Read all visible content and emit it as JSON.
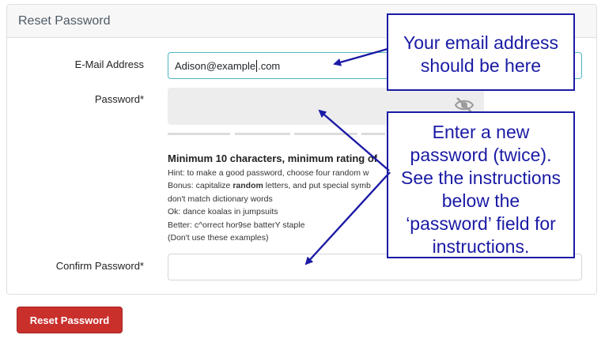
{
  "card": {
    "title": "Reset Password"
  },
  "form": {
    "email": {
      "label": "E-Mail Address",
      "value_before": "Adison@example",
      "value_after": ".com"
    },
    "password": {
      "label": "Password*"
    },
    "confirm": {
      "label": "Confirm Password*"
    }
  },
  "hints": {
    "title": "Minimum 10 characters, minimum rating of",
    "line1": "Hint: to make a good password, choose four random w",
    "line2_pre": "Bonus: capitalize ",
    "line2_bold": "random",
    "line2_post": " letters, and put special symb",
    "line3": "don't match dictionary words",
    "line4": "Ok: dance koalas in jumpsuits",
    "line5": "Better: c^orrect hor9se batterY staple",
    "line6": "(Don't use these examples)"
  },
  "buttons": {
    "reset": "Reset Password"
  },
  "callouts": {
    "email_note": [
      "Your email address",
      "should be here"
    ],
    "password_note": [
      "Enter a new",
      "password (twice).",
      "See the instructions",
      "below the",
      "‘password’ field for",
      "instructions."
    ]
  },
  "icons": {
    "password_toggle": "eye-slash-icon"
  },
  "colors": {
    "accent": "#1a1aa5",
    "button": "#c9302c",
    "input_focus": "#4fb7c4"
  }
}
